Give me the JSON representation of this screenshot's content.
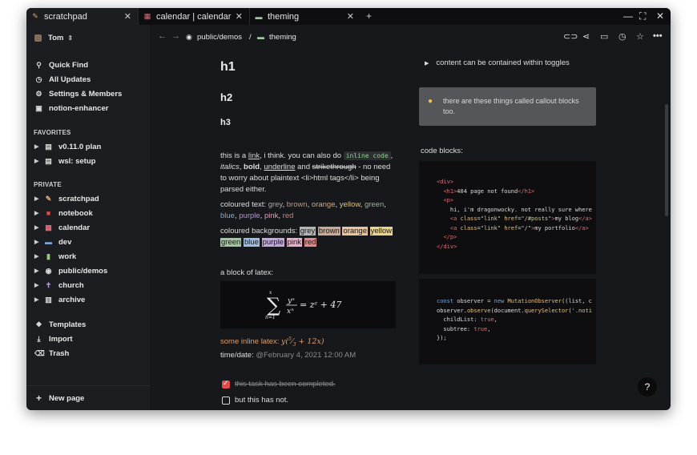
{
  "tabs": [
    {
      "label": "scratchpad",
      "icon": "pencil-icon"
    },
    {
      "label": "calendar | calendar",
      "icon": "calendar-icon"
    },
    {
      "label": "theming",
      "icon": "palette-icon"
    }
  ],
  "window_controls": {
    "minimize": "—",
    "maximize": "⛶",
    "close": "✕"
  },
  "sidebar": {
    "workspace": "Tom",
    "top_items": [
      {
        "label": "Quick Find",
        "icon": "search-icon"
      },
      {
        "label": "All Updates",
        "icon": "clock-icon"
      },
      {
        "label": "Settings & Members",
        "icon": "gear-icon"
      },
      {
        "label": "notion-enhancer",
        "icon": "enhancer-icon"
      }
    ],
    "favorites_heading": "FAVORITES",
    "favorites": [
      {
        "label": "v0.11.0 plan",
        "icon": "page-icon"
      },
      {
        "label": "wsl: setup",
        "icon": "page-icon"
      }
    ],
    "private_heading": "PRIVATE",
    "private": [
      {
        "label": "scratchpad",
        "icon": "pencil-icon"
      },
      {
        "label": "notebook",
        "icon": "notebook-icon"
      },
      {
        "label": "calendar",
        "icon": "calendar-icon"
      },
      {
        "label": "dev",
        "icon": "laptop-icon"
      },
      {
        "label": "work",
        "icon": "briefcase-icon"
      },
      {
        "label": "public/demos",
        "icon": "eye-icon"
      },
      {
        "label": "church",
        "icon": "cross-icon"
      },
      {
        "label": "archive",
        "icon": "archive-icon"
      }
    ],
    "bottom_items": [
      {
        "label": "Templates",
        "icon": "templates-icon"
      },
      {
        "label": "Import",
        "icon": "import-icon"
      },
      {
        "label": "Trash",
        "icon": "trash-icon"
      }
    ],
    "new_page": "New page"
  },
  "breadcrumb": {
    "parent": "public/demos",
    "separator": "/",
    "current": "theming"
  },
  "content": {
    "h1": "h1",
    "h2": "h2",
    "h3": "h3",
    "para": {
      "p1": "this is a ",
      "link": "link",
      "p2": ", i think. you can also do ",
      "code": "inline code",
      "p3": ",",
      "italics": "italics",
      "comma": ", ",
      "bold": "bold",
      "p4": ", ",
      "underline": "underline",
      "p5": " and ",
      "strike": "strikethrough",
      "p6": " - no need to worry about plaintext <li>html tags</li> being parsed either."
    },
    "coloured_text_label": "coloured text:",
    "coloured_text": [
      {
        "word": "grey",
        "color": "#a8a8a8"
      },
      {
        "word": "brown",
        "color": "#b89a83"
      },
      {
        "word": "orange",
        "color": "#e0a86e"
      },
      {
        "word": "yellow",
        "color": "#e3c26a"
      },
      {
        "word": "green",
        "color": "#8fb98f"
      },
      {
        "word": "blue",
        "color": "#8aa9cf"
      },
      {
        "word": "purple",
        "color": "#b396d0"
      },
      {
        "word": "pink",
        "color": "#e0a0c0"
      },
      {
        "word": "red",
        "color": "#de7b7b"
      }
    ],
    "coloured_bg_label": "coloured backgrounds:",
    "coloured_bgs": [
      {
        "word": "grey",
        "bg": "#b5b5b5"
      },
      {
        "word": "brown",
        "bg": "#c9a995"
      },
      {
        "word": "orange",
        "bg": "#e8c29b"
      },
      {
        "word": "yellow",
        "bg": "#ead38a"
      },
      {
        "word": "green",
        "bg": "#9fc79f"
      },
      {
        "word": "blue",
        "bg": "#9ebbe0"
      },
      {
        "word": "purple",
        "bg": "#c3a8df"
      },
      {
        "word": "pink",
        "bg": "#e8afca"
      },
      {
        "word": "red",
        "bg": "#e08a8a"
      }
    ],
    "latex_label": "a block of latex:",
    "inline_latex_label": "some inline latex:",
    "time_label": "time/date:",
    "time_value": "@February 4, 2021 12:00 AM",
    "task_done": "this task has been completed.",
    "task_todo": "but this has not.",
    "toggle": "content can be contained within toggles",
    "callout": "there are these things called callout blocks too.",
    "code_label": "code blocks:"
  },
  "colors": {
    "accent": "#e34a4a",
    "callout_bg": "#545659",
    "code_bg": "#0e0e10"
  }
}
